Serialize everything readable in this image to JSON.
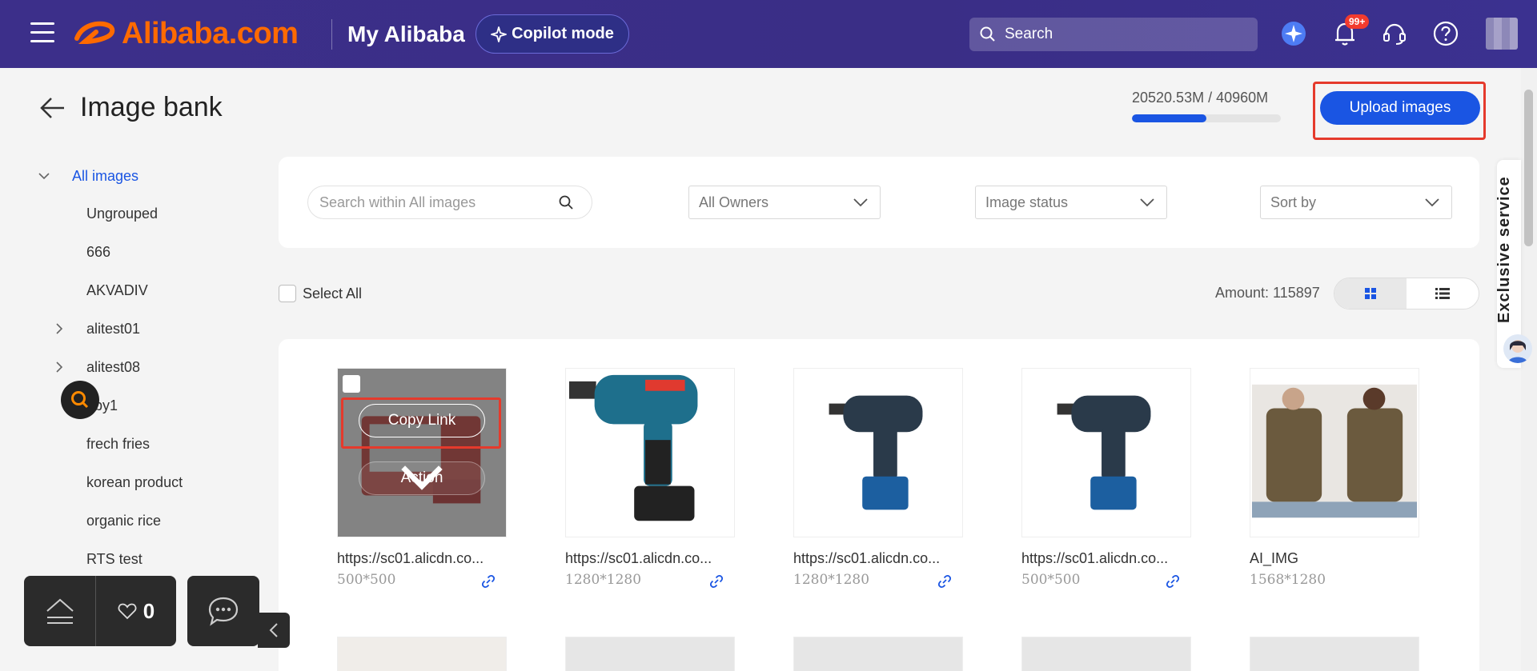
{
  "header": {
    "logo_text": "Alibaba.com",
    "section_title": "My Alibaba",
    "copilot_label": "Copilot mode",
    "search_placeholder": "Search",
    "notification_badge": "99+"
  },
  "page": {
    "title": "Image bank",
    "storage_text": "20520.53M / 40960M",
    "storage_fraction": 0.501,
    "upload_label": "Upload images"
  },
  "sidebar": {
    "items": [
      {
        "label": "All images"
      },
      {
        "label": "Ungrouped"
      },
      {
        "label": "666"
      },
      {
        "label": "AKVADIV"
      },
      {
        "label": "alitest01"
      },
      {
        "label": "alitest08"
      },
      {
        "label": "aby1"
      },
      {
        "label": "frech fries"
      },
      {
        "label": "korean product"
      },
      {
        "label": "organic rice"
      },
      {
        "label": "RTS test"
      }
    ]
  },
  "filters": {
    "search_placeholder": "Search within All images",
    "owners": "All Owners",
    "status": "Image status",
    "sort": "Sort by"
  },
  "list": {
    "select_all": "Select All",
    "amount": "Amount: 115897"
  },
  "tiles": [
    {
      "name": "https://sc01.alicdn.co...",
      "size": "500*500"
    },
    {
      "name": "https://sc01.alicdn.co...",
      "size": "1280*1280"
    },
    {
      "name": "https://sc01.alicdn.co...",
      "size": "1280*1280"
    },
    {
      "name": "https://sc01.alicdn.co...",
      "size": "500*500"
    },
    {
      "name": "AI_IMG",
      "size": "1568*1280"
    }
  ],
  "overlay": {
    "copy_link": "Copy Link",
    "action": "Action"
  },
  "right_tab": {
    "service_label": "Exclusive service"
  },
  "dock": {
    "fav_count": "0"
  },
  "colors": {
    "brand_orange": "#ff6a00",
    "header_bg": "#3a2e86",
    "primary_blue": "#1a55e3",
    "highlight_red": "#e53a2c"
  }
}
